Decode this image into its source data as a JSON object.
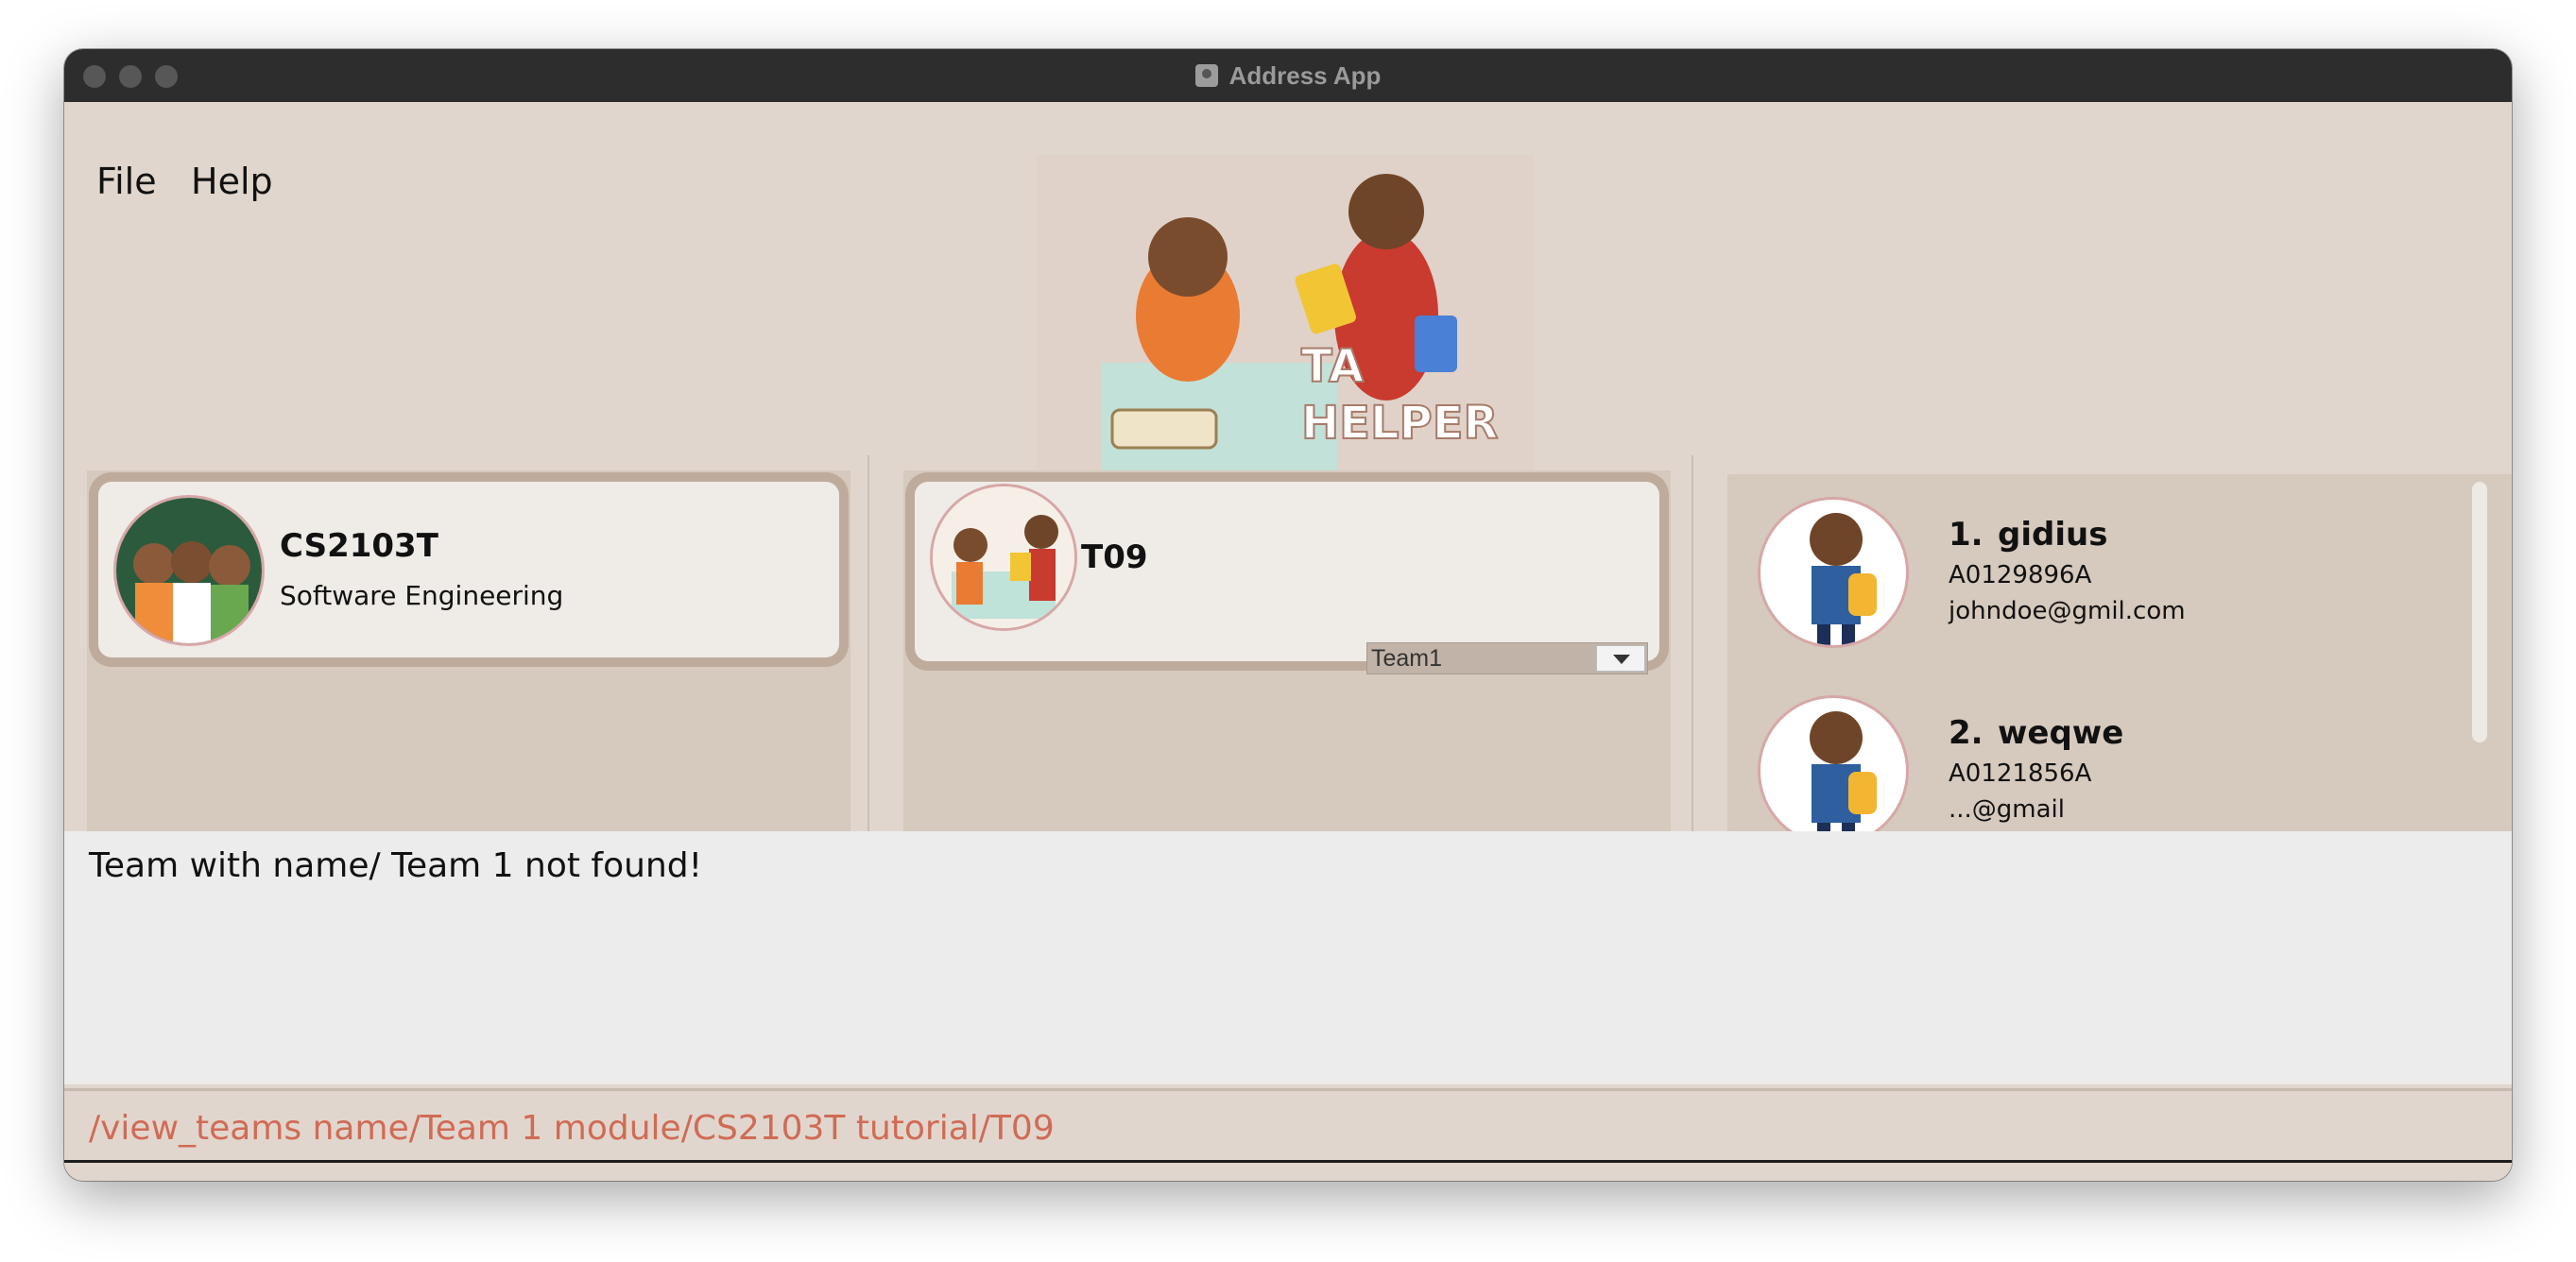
{
  "window": {
    "title": "Address App"
  },
  "menu": {
    "file": "File",
    "help": "Help"
  },
  "module_card": {
    "code": "CS2103T",
    "name": "Software Engineering"
  },
  "tutorial_card": {
    "code": "T09",
    "team_select": "Team1"
  },
  "people": [
    {
      "index": "1.",
      "name": "gidius",
      "id": "A0129896A",
      "email": "johndoe@gmil.com"
    },
    {
      "index": "2.",
      "name": "weqwe",
      "id": "A0121856A",
      "email": "...@gmail"
    }
  ],
  "feedback": {
    "message": "Team with name/ Team 1 not found!"
  },
  "command": {
    "value": "/view_teams name/Team 1 module/CS2103T tutorial/T09"
  },
  "colors": {
    "panel": "#d6c9be",
    "card": "#efebe7",
    "accent_text": "#d06b55"
  }
}
